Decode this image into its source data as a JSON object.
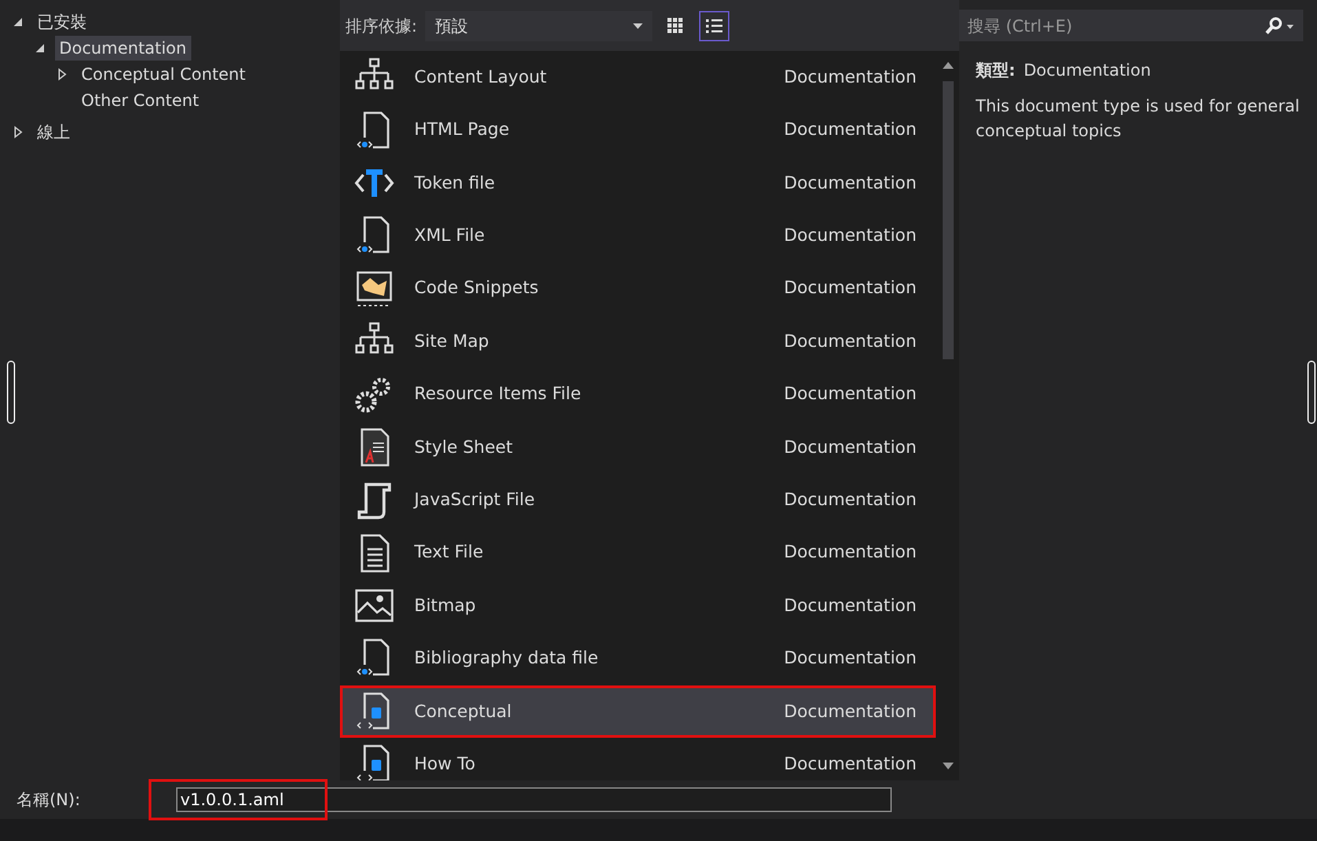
{
  "tree": [
    {
      "label": "已安裝",
      "expanded": true,
      "selected": false,
      "children": [
        {
          "label": "Documentation",
          "expanded": true,
          "selected": true,
          "children": [
            {
              "label": "Conceptual Content",
              "expanded": false,
              "selected": false
            },
            {
              "label": "Other Content",
              "selected": false
            }
          ]
        }
      ]
    },
    {
      "label": "線上",
      "expanded": false,
      "selected": false
    }
  ],
  "sort": {
    "label": "排序依據:",
    "value": "預設"
  },
  "view_buttons": [
    {
      "kind": "grid",
      "selected": false
    },
    {
      "kind": "list",
      "selected": true
    }
  ],
  "templates": [
    {
      "kind": "sitemap",
      "name": "Content Layout",
      "category": "Documentation",
      "selected": false,
      "highlighted": false
    },
    {
      "kind": "page-code",
      "name": "HTML Page",
      "category": "Documentation",
      "selected": false,
      "highlighted": false
    },
    {
      "kind": "token",
      "name": "Token file",
      "category": "Documentation",
      "selected": false,
      "highlighted": false
    },
    {
      "kind": "page-code",
      "name": "XML File",
      "category": "Documentation",
      "selected": false,
      "highlighted": false
    },
    {
      "kind": "snippet",
      "name": "Code Snippets",
      "category": "Documentation",
      "selected": false,
      "highlighted": false
    },
    {
      "kind": "sitemap",
      "name": "Site Map",
      "category": "Documentation",
      "selected": false,
      "highlighted": false
    },
    {
      "kind": "gears",
      "name": "Resource Items File",
      "category": "Documentation",
      "selected": false,
      "highlighted": false
    },
    {
      "kind": "stylesheet",
      "name": "Style Sheet",
      "category": "Documentation",
      "selected": false,
      "highlighted": false
    },
    {
      "kind": "script",
      "name": "JavaScript File",
      "category": "Documentation",
      "selected": false,
      "highlighted": false
    },
    {
      "kind": "text",
      "name": "Text File",
      "category": "Documentation",
      "selected": false,
      "highlighted": false
    },
    {
      "kind": "image",
      "name": "Bitmap",
      "category": "Documentation",
      "selected": false,
      "highlighted": false
    },
    {
      "kind": "page-code",
      "name": "Bibliography data file",
      "category": "Documentation",
      "selected": false,
      "highlighted": false
    },
    {
      "kind": "page-help",
      "name": "Conceptual",
      "category": "Documentation",
      "selected": true,
      "highlighted": true
    },
    {
      "kind": "page-help",
      "name": "How To",
      "category": "Documentation",
      "selected": false,
      "highlighted": false
    }
  ],
  "search": {
    "placeholder": "搜尋 (Ctrl+E)"
  },
  "details": {
    "type_label": "類型:",
    "type_value": "Documentation",
    "description": "This document type is used for general conceptual topics"
  },
  "name_field": {
    "label": "名稱(N):",
    "value": "v1.0.0.1.aml",
    "highlighted": true
  }
}
